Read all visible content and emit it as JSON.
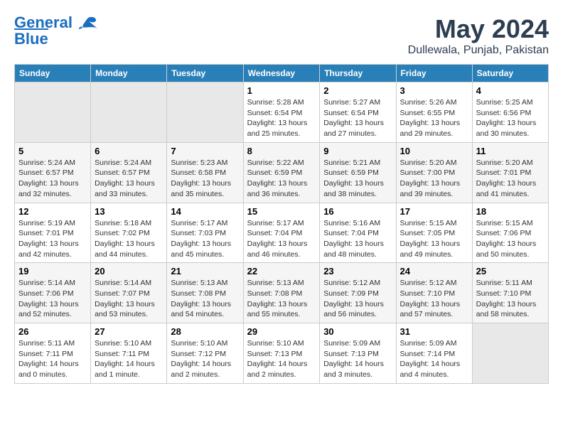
{
  "header": {
    "logo_line1": "General",
    "logo_line2": "Blue",
    "month": "May 2024",
    "location": "Dullewala, Punjab, Pakistan"
  },
  "weekdays": [
    "Sunday",
    "Monday",
    "Tuesday",
    "Wednesday",
    "Thursday",
    "Friday",
    "Saturday"
  ],
  "weeks": [
    [
      {
        "day": "",
        "info": ""
      },
      {
        "day": "",
        "info": ""
      },
      {
        "day": "",
        "info": ""
      },
      {
        "day": "1",
        "info": "Sunrise: 5:28 AM\nSunset: 6:54 PM\nDaylight: 13 hours\nand 25 minutes."
      },
      {
        "day": "2",
        "info": "Sunrise: 5:27 AM\nSunset: 6:54 PM\nDaylight: 13 hours\nand 27 minutes."
      },
      {
        "day": "3",
        "info": "Sunrise: 5:26 AM\nSunset: 6:55 PM\nDaylight: 13 hours\nand 29 minutes."
      },
      {
        "day": "4",
        "info": "Sunrise: 5:25 AM\nSunset: 6:56 PM\nDaylight: 13 hours\nand 30 minutes."
      }
    ],
    [
      {
        "day": "5",
        "info": "Sunrise: 5:24 AM\nSunset: 6:57 PM\nDaylight: 13 hours\nand 32 minutes."
      },
      {
        "day": "6",
        "info": "Sunrise: 5:24 AM\nSunset: 6:57 PM\nDaylight: 13 hours\nand 33 minutes."
      },
      {
        "day": "7",
        "info": "Sunrise: 5:23 AM\nSunset: 6:58 PM\nDaylight: 13 hours\nand 35 minutes."
      },
      {
        "day": "8",
        "info": "Sunrise: 5:22 AM\nSunset: 6:59 PM\nDaylight: 13 hours\nand 36 minutes."
      },
      {
        "day": "9",
        "info": "Sunrise: 5:21 AM\nSunset: 6:59 PM\nDaylight: 13 hours\nand 38 minutes."
      },
      {
        "day": "10",
        "info": "Sunrise: 5:20 AM\nSunset: 7:00 PM\nDaylight: 13 hours\nand 39 minutes."
      },
      {
        "day": "11",
        "info": "Sunrise: 5:20 AM\nSunset: 7:01 PM\nDaylight: 13 hours\nand 41 minutes."
      }
    ],
    [
      {
        "day": "12",
        "info": "Sunrise: 5:19 AM\nSunset: 7:01 PM\nDaylight: 13 hours\nand 42 minutes."
      },
      {
        "day": "13",
        "info": "Sunrise: 5:18 AM\nSunset: 7:02 PM\nDaylight: 13 hours\nand 44 minutes."
      },
      {
        "day": "14",
        "info": "Sunrise: 5:17 AM\nSunset: 7:03 PM\nDaylight: 13 hours\nand 45 minutes."
      },
      {
        "day": "15",
        "info": "Sunrise: 5:17 AM\nSunset: 7:04 PM\nDaylight: 13 hours\nand 46 minutes."
      },
      {
        "day": "16",
        "info": "Sunrise: 5:16 AM\nSunset: 7:04 PM\nDaylight: 13 hours\nand 48 minutes."
      },
      {
        "day": "17",
        "info": "Sunrise: 5:15 AM\nSunset: 7:05 PM\nDaylight: 13 hours\nand 49 minutes."
      },
      {
        "day": "18",
        "info": "Sunrise: 5:15 AM\nSunset: 7:06 PM\nDaylight: 13 hours\nand 50 minutes."
      }
    ],
    [
      {
        "day": "19",
        "info": "Sunrise: 5:14 AM\nSunset: 7:06 PM\nDaylight: 13 hours\nand 52 minutes."
      },
      {
        "day": "20",
        "info": "Sunrise: 5:14 AM\nSunset: 7:07 PM\nDaylight: 13 hours\nand 53 minutes."
      },
      {
        "day": "21",
        "info": "Sunrise: 5:13 AM\nSunset: 7:08 PM\nDaylight: 13 hours\nand 54 minutes."
      },
      {
        "day": "22",
        "info": "Sunrise: 5:13 AM\nSunset: 7:08 PM\nDaylight: 13 hours\nand 55 minutes."
      },
      {
        "day": "23",
        "info": "Sunrise: 5:12 AM\nSunset: 7:09 PM\nDaylight: 13 hours\nand 56 minutes."
      },
      {
        "day": "24",
        "info": "Sunrise: 5:12 AM\nSunset: 7:10 PM\nDaylight: 13 hours\nand 57 minutes."
      },
      {
        "day": "25",
        "info": "Sunrise: 5:11 AM\nSunset: 7:10 PM\nDaylight: 13 hours\nand 58 minutes."
      }
    ],
    [
      {
        "day": "26",
        "info": "Sunrise: 5:11 AM\nSunset: 7:11 PM\nDaylight: 14 hours\nand 0 minutes."
      },
      {
        "day": "27",
        "info": "Sunrise: 5:10 AM\nSunset: 7:11 PM\nDaylight: 14 hours\nand 1 minute."
      },
      {
        "day": "28",
        "info": "Sunrise: 5:10 AM\nSunset: 7:12 PM\nDaylight: 14 hours\nand 2 minutes."
      },
      {
        "day": "29",
        "info": "Sunrise: 5:10 AM\nSunset: 7:13 PM\nDaylight: 14 hours\nand 2 minutes."
      },
      {
        "day": "30",
        "info": "Sunrise: 5:09 AM\nSunset: 7:13 PM\nDaylight: 14 hours\nand 3 minutes."
      },
      {
        "day": "31",
        "info": "Sunrise: 5:09 AM\nSunset: 7:14 PM\nDaylight: 14 hours\nand 4 minutes."
      },
      {
        "day": "",
        "info": ""
      }
    ]
  ]
}
